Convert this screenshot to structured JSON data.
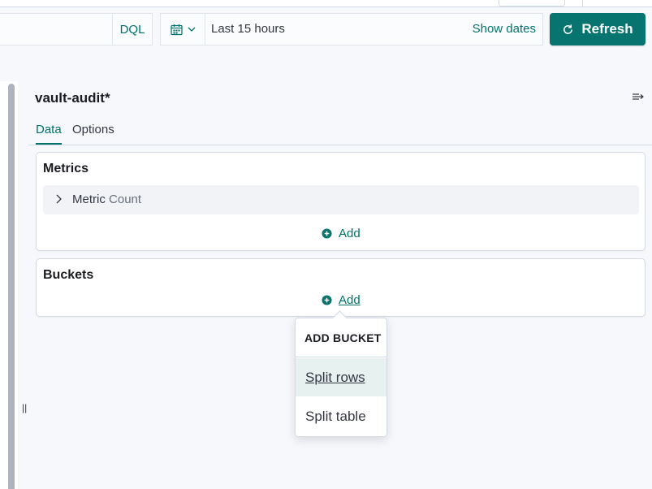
{
  "query": {
    "language_label": "DQL"
  },
  "datepicker": {
    "range_label": "Last 15 hours",
    "show_dates_label": "Show dates"
  },
  "refresh": {
    "label": "Refresh"
  },
  "editor": {
    "title": "vault-audit*",
    "tabs": [
      {
        "label": "Data"
      },
      {
        "label": "Options"
      }
    ],
    "metrics": {
      "title": "Metrics",
      "item": {
        "label": "Metric",
        "value": "Count"
      },
      "add_label": "Add"
    },
    "buckets": {
      "title": "Buckets",
      "add_label": "Add"
    },
    "add_bucket_popover": {
      "title": "ADD BUCKET",
      "items": [
        {
          "label": "Split rows"
        },
        {
          "label": "Split table"
        }
      ]
    }
  },
  "colors": {
    "primary": "#07746f",
    "link": "#00726b",
    "highlight": "#e6f1f0"
  }
}
